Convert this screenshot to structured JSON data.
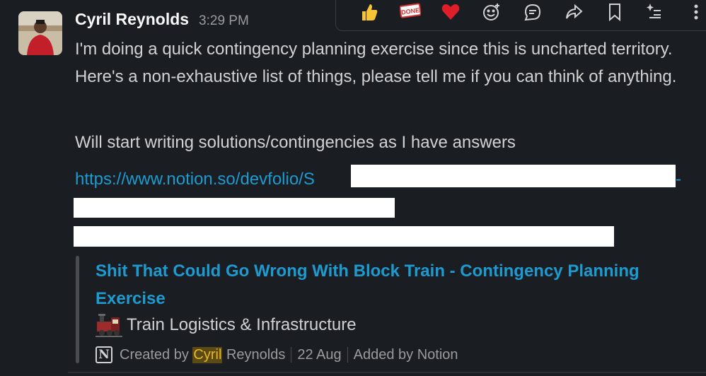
{
  "message": {
    "author": "Cyril Reynolds",
    "time": "3:29 PM",
    "paragraph1": "I'm doing a quick contingency planning exercise since this is uncharted territory. Here's a non-exhaustive list of things, please tell me if you can think of anything.",
    "paragraph2": "Will start writing solutions/contingencies as I have answers",
    "link_text": "https://www.notion.so/devfolio/S",
    "link_tail": "-"
  },
  "unfurl": {
    "title": "Shit That Could Go Wrong With Block Train - Contingency Planning Exercise",
    "subtitle": "Train Logistics & Infrastructure",
    "created_prefix": "Created by",
    "created_highlight": "Cyril",
    "created_suffix": "Reynolds",
    "date": "22 Aug",
    "added_by": "Added by Notion",
    "notion_glyph": "N"
  },
  "toolbar": {
    "icons": [
      "thumbs-up-icon",
      "done-icon",
      "heart-icon",
      "add-reaction-icon",
      "reply-thread-icon",
      "forward-icon",
      "bookmark-icon",
      "more-actions-icon",
      "more-vertical-icon"
    ],
    "done_label": "DONE"
  },
  "colors": {
    "background": "#1a1d21",
    "link": "#1d9bd1",
    "text": "#d1d2d3",
    "highlight": "#e8b829"
  }
}
